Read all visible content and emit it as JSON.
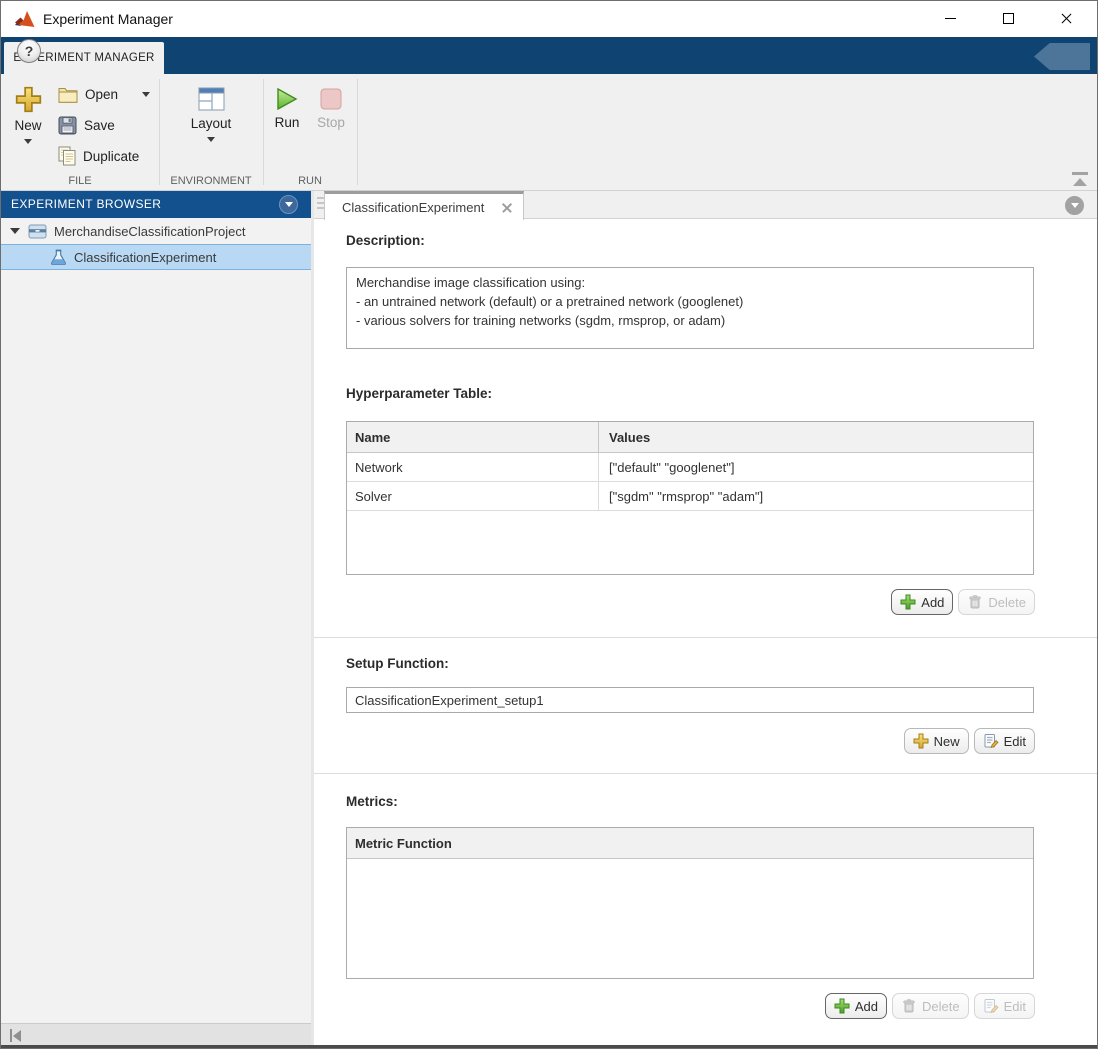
{
  "window": {
    "title": "Experiment Manager"
  },
  "icons": {
    "help_glyph": "?"
  },
  "ribbon": {
    "tab_label": "EXPERIMENT MANAGER",
    "file": {
      "label": "FILE",
      "new": "New",
      "open": "Open",
      "save": "Save",
      "duplicate": "Duplicate"
    },
    "environment": {
      "label": "ENVIRONMENT",
      "layout": "Layout"
    },
    "run_group": {
      "label": "RUN",
      "run": "Run",
      "stop": "Stop"
    }
  },
  "browser": {
    "title": "EXPERIMENT BROWSER",
    "project_label": "MerchandiseClassificationProject",
    "experiment_label": "ClassificationExperiment"
  },
  "main": {
    "tab_label": "ClassificationExperiment",
    "description": {
      "label": "Description:",
      "text": "Merchandise image classification using:\n- an untrained network (default) or a pretrained network (googlenet)\n- various solvers for training networks (sgdm, rmsprop, or adam)"
    },
    "hyperparameters": {
      "label": "Hyperparameter Table:",
      "columns": {
        "name": "Name",
        "values": "Values"
      },
      "rows": [
        {
          "name": "Network",
          "values": "[\"default\" \"googlenet\"]"
        },
        {
          "name": "Solver",
          "values": "[\"sgdm\" \"rmsprop\" \"adam\"]"
        }
      ],
      "add_label": "Add",
      "delete_label": "Delete"
    },
    "setup_function": {
      "label": "Setup Function:",
      "value": "ClassificationExperiment_setup1",
      "new_label": "New",
      "edit_label": "Edit"
    },
    "metrics": {
      "label": "Metrics:",
      "column": "Metric Function",
      "add_label": "Add",
      "delete_label": "Delete",
      "edit_label": "Edit"
    }
  },
  "colors": {
    "ribbon_blue": "#0e4372",
    "panel_header_blue": "#12518e",
    "selection_blue": "#b8d8f3",
    "run_green": "#5bb22c",
    "stop_pink": "#edc6c6",
    "add_green": "#5cb334",
    "new_gold": "#eac63e"
  }
}
